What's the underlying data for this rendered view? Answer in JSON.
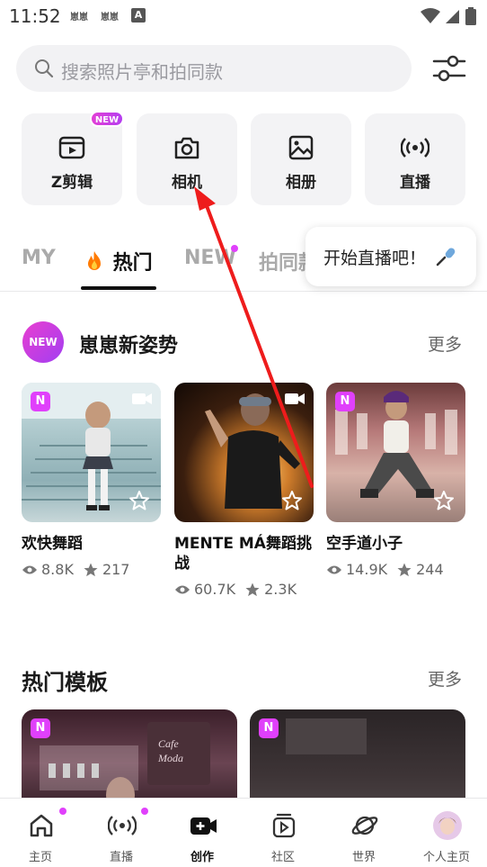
{
  "status_bar": {
    "time": "11:52",
    "notif1": "崽崽",
    "notif2": "崽崽",
    "a_badge": "A"
  },
  "search": {
    "placeholder": "搜索照片亭和拍同款"
  },
  "tiles": [
    {
      "label": "Z剪辑",
      "icon": "video-edit-icon"
    },
    {
      "label": "相机",
      "icon": "camera-icon"
    },
    {
      "label": "相册",
      "icon": "image-icon"
    },
    {
      "label": "直播",
      "icon": "broadcast-icon"
    }
  ],
  "tile_new_badge": "NEW",
  "tabs": [
    {
      "label": "MY"
    },
    {
      "label": "热门",
      "icon": "fire-icon"
    },
    {
      "label": "NEW"
    },
    {
      "label": "拍同款"
    }
  ],
  "tooltip": {
    "text": "开始直播吧！",
    "icon": "microphone-icon"
  },
  "section1": {
    "badge": "NEW",
    "title": "崽崽新姿势",
    "more": "更多",
    "cards": [
      {
        "title": "欢快舞蹈",
        "views": "8.8K",
        "stars": "217"
      },
      {
        "title": "MENTE MÁ舞蹈挑战",
        "views": "60.7K",
        "stars": "2.3K"
      },
      {
        "title": "空手道小子",
        "views": "14.9K",
        "stars": "244"
      }
    ]
  },
  "section2": {
    "title": "热门模板",
    "more": "更多"
  },
  "bottom_nav": [
    {
      "label": "主页",
      "icon": "home-icon"
    },
    {
      "label": "直播",
      "icon": "live-icon"
    },
    {
      "label": "创作",
      "icon": "create-icon"
    },
    {
      "label": "社区",
      "icon": "community-icon"
    },
    {
      "label": "世界",
      "icon": "planet-icon"
    },
    {
      "label": "个人主页",
      "icon": "avatar"
    }
  ],
  "colors": {
    "accent": "#e040fb",
    "arrow": "#ee1c1c",
    "tile_bg": "#f3f3f5"
  }
}
